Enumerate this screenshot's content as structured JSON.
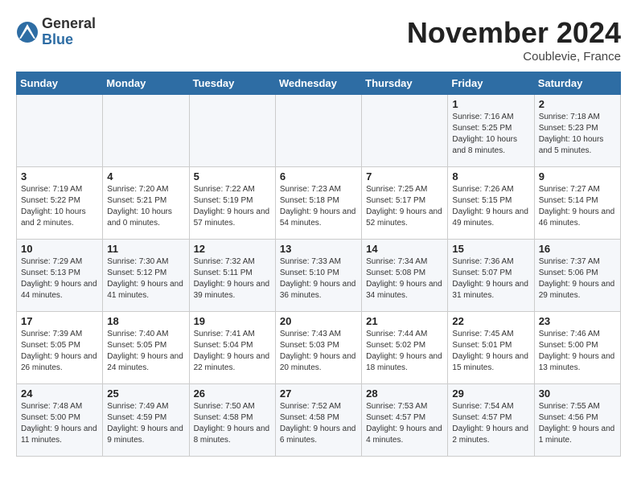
{
  "logo": {
    "general": "General",
    "blue": "Blue"
  },
  "title": "November 2024",
  "subtitle": "Coublevie, France",
  "days_of_week": [
    "Sunday",
    "Monday",
    "Tuesday",
    "Wednesday",
    "Thursday",
    "Friday",
    "Saturday"
  ],
  "weeks": [
    [
      {
        "day": "",
        "info": ""
      },
      {
        "day": "",
        "info": ""
      },
      {
        "day": "",
        "info": ""
      },
      {
        "day": "",
        "info": ""
      },
      {
        "day": "",
        "info": ""
      },
      {
        "day": "1",
        "info": "Sunrise: 7:16 AM\nSunset: 5:25 PM\nDaylight: 10 hours\nand 8 minutes."
      },
      {
        "day": "2",
        "info": "Sunrise: 7:18 AM\nSunset: 5:23 PM\nDaylight: 10 hours\nand 5 minutes."
      }
    ],
    [
      {
        "day": "3",
        "info": "Sunrise: 7:19 AM\nSunset: 5:22 PM\nDaylight: 10 hours\nand 2 minutes."
      },
      {
        "day": "4",
        "info": "Sunrise: 7:20 AM\nSunset: 5:21 PM\nDaylight: 10 hours\nand 0 minutes."
      },
      {
        "day": "5",
        "info": "Sunrise: 7:22 AM\nSunset: 5:19 PM\nDaylight: 9 hours\nand 57 minutes."
      },
      {
        "day": "6",
        "info": "Sunrise: 7:23 AM\nSunset: 5:18 PM\nDaylight: 9 hours\nand 54 minutes."
      },
      {
        "day": "7",
        "info": "Sunrise: 7:25 AM\nSunset: 5:17 PM\nDaylight: 9 hours\nand 52 minutes."
      },
      {
        "day": "8",
        "info": "Sunrise: 7:26 AM\nSunset: 5:15 PM\nDaylight: 9 hours\nand 49 minutes."
      },
      {
        "day": "9",
        "info": "Sunrise: 7:27 AM\nSunset: 5:14 PM\nDaylight: 9 hours\nand 46 minutes."
      }
    ],
    [
      {
        "day": "10",
        "info": "Sunrise: 7:29 AM\nSunset: 5:13 PM\nDaylight: 9 hours\nand 44 minutes."
      },
      {
        "day": "11",
        "info": "Sunrise: 7:30 AM\nSunset: 5:12 PM\nDaylight: 9 hours\nand 41 minutes."
      },
      {
        "day": "12",
        "info": "Sunrise: 7:32 AM\nSunset: 5:11 PM\nDaylight: 9 hours\nand 39 minutes."
      },
      {
        "day": "13",
        "info": "Sunrise: 7:33 AM\nSunset: 5:10 PM\nDaylight: 9 hours\nand 36 minutes."
      },
      {
        "day": "14",
        "info": "Sunrise: 7:34 AM\nSunset: 5:08 PM\nDaylight: 9 hours\nand 34 minutes."
      },
      {
        "day": "15",
        "info": "Sunrise: 7:36 AM\nSunset: 5:07 PM\nDaylight: 9 hours\nand 31 minutes."
      },
      {
        "day": "16",
        "info": "Sunrise: 7:37 AM\nSunset: 5:06 PM\nDaylight: 9 hours\nand 29 minutes."
      }
    ],
    [
      {
        "day": "17",
        "info": "Sunrise: 7:39 AM\nSunset: 5:05 PM\nDaylight: 9 hours\nand 26 minutes."
      },
      {
        "day": "18",
        "info": "Sunrise: 7:40 AM\nSunset: 5:05 PM\nDaylight: 9 hours\nand 24 minutes."
      },
      {
        "day": "19",
        "info": "Sunrise: 7:41 AM\nSunset: 5:04 PM\nDaylight: 9 hours\nand 22 minutes."
      },
      {
        "day": "20",
        "info": "Sunrise: 7:43 AM\nSunset: 5:03 PM\nDaylight: 9 hours\nand 20 minutes."
      },
      {
        "day": "21",
        "info": "Sunrise: 7:44 AM\nSunset: 5:02 PM\nDaylight: 9 hours\nand 18 minutes."
      },
      {
        "day": "22",
        "info": "Sunrise: 7:45 AM\nSunset: 5:01 PM\nDaylight: 9 hours\nand 15 minutes."
      },
      {
        "day": "23",
        "info": "Sunrise: 7:46 AM\nSunset: 5:00 PM\nDaylight: 9 hours\nand 13 minutes."
      }
    ],
    [
      {
        "day": "24",
        "info": "Sunrise: 7:48 AM\nSunset: 5:00 PM\nDaylight: 9 hours\nand 11 minutes."
      },
      {
        "day": "25",
        "info": "Sunrise: 7:49 AM\nSunset: 4:59 PM\nDaylight: 9 hours\nand 9 minutes."
      },
      {
        "day": "26",
        "info": "Sunrise: 7:50 AM\nSunset: 4:58 PM\nDaylight: 9 hours\nand 8 minutes."
      },
      {
        "day": "27",
        "info": "Sunrise: 7:52 AM\nSunset: 4:58 PM\nDaylight: 9 hours\nand 6 minutes."
      },
      {
        "day": "28",
        "info": "Sunrise: 7:53 AM\nSunset: 4:57 PM\nDaylight: 9 hours\nand 4 minutes."
      },
      {
        "day": "29",
        "info": "Sunrise: 7:54 AM\nSunset: 4:57 PM\nDaylight: 9 hours\nand 2 minutes."
      },
      {
        "day": "30",
        "info": "Sunrise: 7:55 AM\nSunset: 4:56 PM\nDaylight: 9 hours\nand 1 minute."
      }
    ]
  ]
}
